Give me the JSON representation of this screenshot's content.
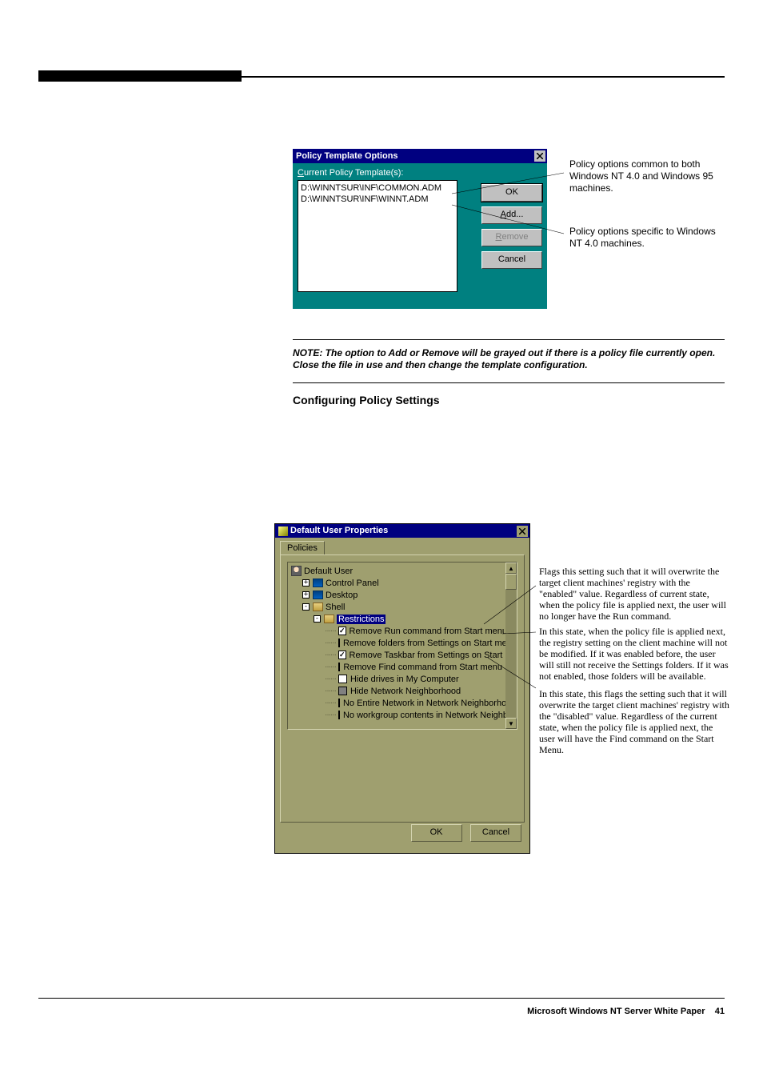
{
  "dialog1": {
    "title": "Policy Template Options",
    "label_pre": "C",
    "label_rest": "urrent Policy Template(s):",
    "list": {
      "item1": "D:\\WINNTSUR\\INF\\COMMON.ADM",
      "item2": "D:\\WINNTSUR\\INF\\WINNT.ADM"
    },
    "buttons": {
      "ok": "OK",
      "add": "Add...",
      "remove": "Remove",
      "cancel": "Cancel"
    }
  },
  "callouts_d1": {
    "a": "Policy options common to both Windows NT 4.0 and Windows 95 machines.",
    "b": "Policy options specific to Windows NT 4.0 machines."
  },
  "note_text": "NOTE: The option to Add or Remove will be grayed out if there is a policy file currently open. Close the file in use and then change the template configuration.",
  "heading": "Configuring Policy Settings",
  "dialog2": {
    "title": "Default User Properties",
    "tab": "Policies",
    "tree": {
      "root": "Default User",
      "n1": "Control Panel",
      "n2": "Desktop",
      "n3": "Shell",
      "n3a": "Restrictions",
      "i1": "Remove Run command from Start menu",
      "i2": "Remove folders from Settings on Start menu",
      "i3": "Remove Taskbar from Settings on Start menu",
      "i4": "Remove Find command from Start menu",
      "i5": "Hide drives in My Computer",
      "i6": "Hide Network Neighborhood",
      "i7": "No Entire Network in Network Neighborhood",
      "i8": "No workgroup contents in Network Neighborhood"
    },
    "buttons": {
      "ok": "OK",
      "cancel": "Cancel"
    }
  },
  "callouts_d2": {
    "a": "Flags this setting such that it will overwrite the target client machines' registry with the \"enabled\" value. Regardless of current state, when the policy file is applied next, the user will no longer have the Run command.",
    "b": "In this state, when the policy file is applied next, the registry setting on the client machine will not be modified.  If it was enabled before, the user will still not receive the Settings folders.  If it was not enabled, those folders will be available.",
    "c": "In this state, this flags the setting such that it will overwrite the target client machines' registry with the \"disabled\" value.  Regardless of the current state, when the policy file is applied next, the user will have the Find command on the Start Menu."
  },
  "footer": {
    "text": "Microsoft Windows NT Server White Paper",
    "page": "41"
  }
}
